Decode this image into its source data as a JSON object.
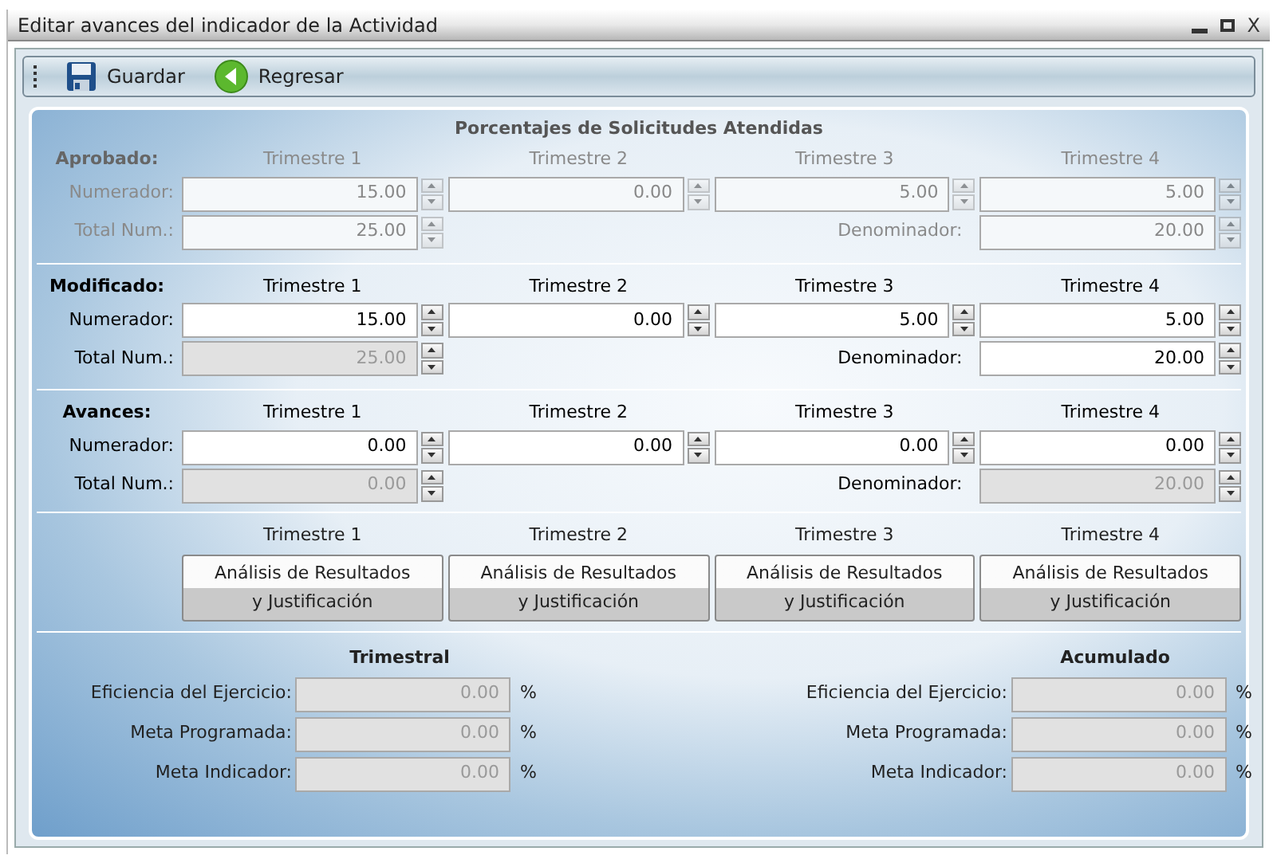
{
  "window": {
    "title": "Editar avances del indicador de la Actividad",
    "close_label": "X"
  },
  "toolbar": [
    {
      "kind": "save",
      "label": "Guardar"
    },
    {
      "kind": "back",
      "label": "Regresar"
    }
  ],
  "panel_title": "Porcentajes de Solicitudes Atendidas",
  "sections": [
    {
      "title": "Aprobado:",
      "disabled": true,
      "columns": [
        "Trimestre 1",
        "Trimestre 2",
        "Trimestre 3",
        "Trimestre 4"
      ],
      "numerador": {
        "label": "Numerador:",
        "values": [
          {
            "value": "15.00",
            "disabled": false
          },
          {
            "value": "0.00",
            "disabled": false
          },
          {
            "value": "5.00",
            "disabled": false
          },
          {
            "value": "5.00",
            "disabled": false
          }
        ]
      },
      "total": {
        "label": "Total Num.:",
        "value": "25.00",
        "disabled": false
      },
      "denominador": {
        "label": "Denominador:",
        "value": "20.00",
        "disabled": false
      }
    },
    {
      "title": "Modificado:",
      "disabled": false,
      "columns": [
        "Trimestre 1",
        "Trimestre 2",
        "Trimestre 3",
        "Trimestre 4"
      ],
      "numerador": {
        "label": "Numerador:",
        "values": [
          {
            "value": "15.00",
            "disabled": false
          },
          {
            "value": "0.00",
            "disabled": false
          },
          {
            "value": "5.00",
            "disabled": false
          },
          {
            "value": "5.00",
            "disabled": false
          }
        ]
      },
      "total": {
        "label": "Total Num.:",
        "value": "25.00",
        "disabled": true
      },
      "denominador": {
        "label": "Denominador:",
        "value": "20.00",
        "disabled": false
      }
    },
    {
      "title": "Avances:",
      "disabled": false,
      "columns": [
        "Trimestre 1",
        "Trimestre 2",
        "Trimestre 3",
        "Trimestre 4"
      ],
      "numerador": {
        "label": "Numerador:",
        "values": [
          {
            "value": "0.00",
            "disabled": false
          },
          {
            "value": "0.00",
            "disabled": false
          },
          {
            "value": "0.00",
            "disabled": false
          },
          {
            "value": "0.00",
            "disabled": false
          }
        ]
      },
      "total": {
        "label": "Total Num.:",
        "value": "0.00",
        "disabled": true
      },
      "denominador": {
        "label": "Denominador:",
        "value": "20.00",
        "disabled": true
      }
    }
  ],
  "analysis": {
    "columns": [
      "Trimestre 1",
      "Trimestre 2",
      "Trimestre 3",
      "Trimestre 4"
    ],
    "buttons": [
      {
        "lines": [
          "Análisis de Resultados",
          "y Justificación"
        ]
      },
      {
        "lines": [
          "Análisis de Resultados",
          "y Justificación"
        ]
      },
      {
        "lines": [
          "Análisis de Resultados",
          "y Justificación"
        ]
      },
      {
        "lines": [
          "Análisis de Resultados",
          "y Justificación"
        ]
      }
    ]
  },
  "summary": [
    {
      "title": "Trimestral",
      "rows": [
        {
          "label": "Eficiencia del Ejercicio:",
          "value": "0.00",
          "unit": "%"
        },
        {
          "label": "Meta Programada:",
          "value": "0.00",
          "unit": "%"
        },
        {
          "label": "Meta Indicador:",
          "value": "0.00",
          "unit": "%"
        }
      ]
    },
    {
      "title": "Acumulado",
      "rows": [
        {
          "label": "Eficiencia del Ejercicio:",
          "value": "0.00",
          "unit": "%"
        },
        {
          "label": "Meta Programada:",
          "value": "0.00",
          "unit": "%"
        },
        {
          "label": "Meta Indicador:",
          "value": "0.00",
          "unit": "%"
        }
      ]
    }
  ]
}
